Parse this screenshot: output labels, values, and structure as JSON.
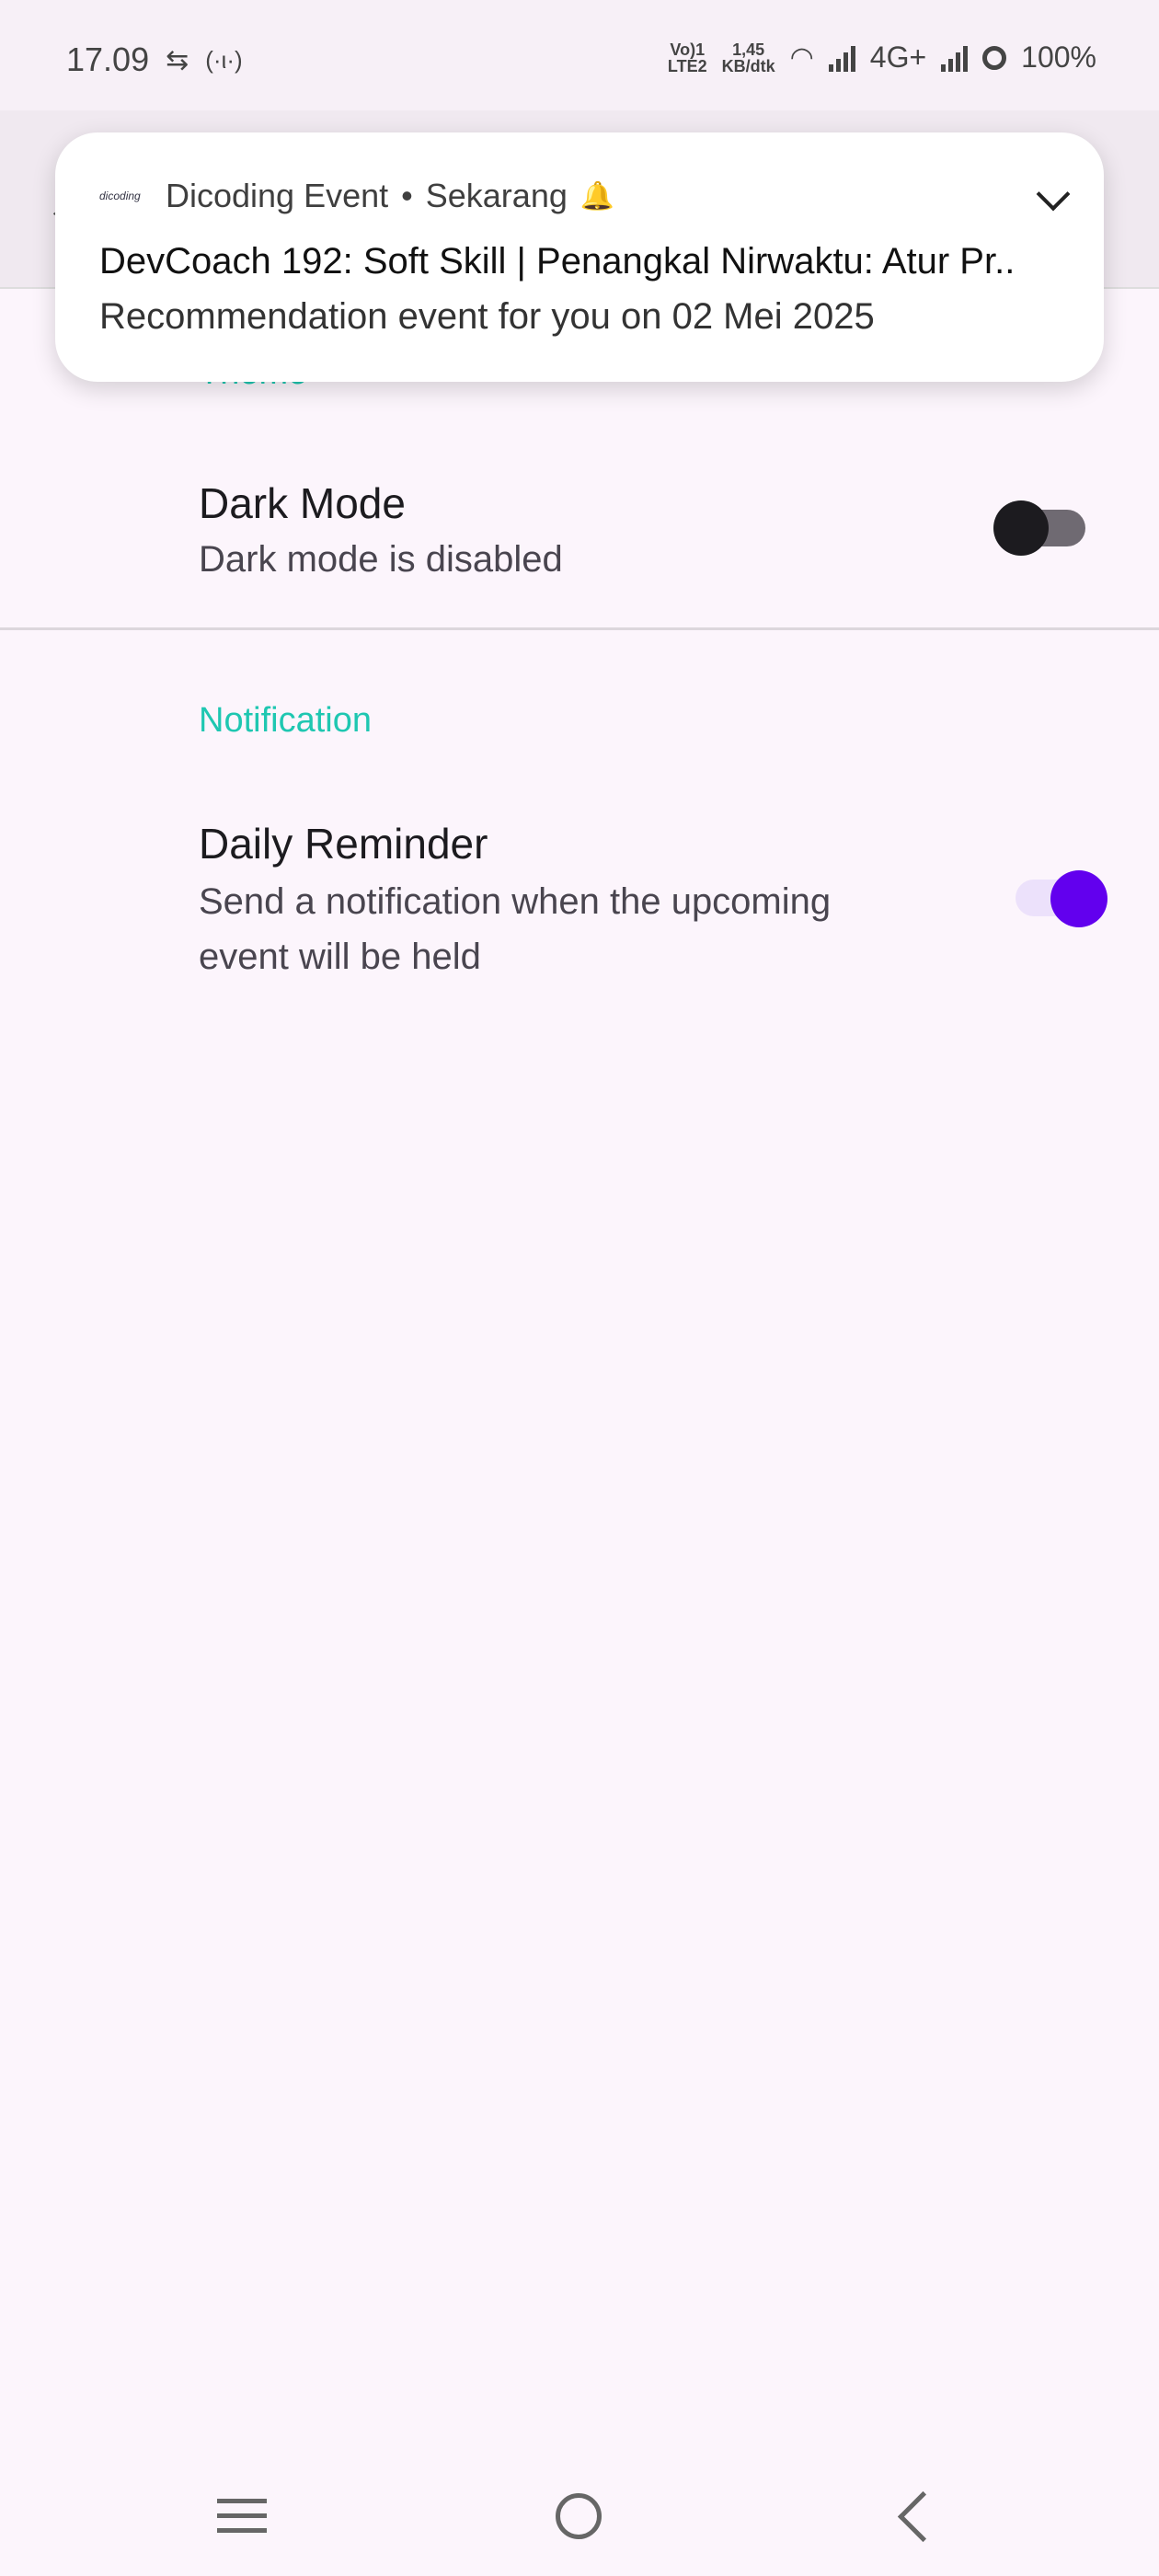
{
  "status_bar": {
    "time": "17.09",
    "volte_top": "Vo)1",
    "volte_bottom": "LTE2",
    "speed_top": "1,45",
    "speed_bottom": "KB/dtk",
    "network": "4G+",
    "battery": "100%"
  },
  "notification": {
    "logo_text": "dicoding",
    "app_name": "Dicoding Event",
    "separator": "•",
    "time": "Sekarang",
    "title": "DevCoach 192: Soft Skill | Penangkal Nirwaktu: Atur Pr..",
    "body": "Recommendation event for you on 02 Mei 2025"
  },
  "settings": {
    "theme_section": "Theme",
    "dark_mode": {
      "title": "Dark Mode",
      "subtitle": "Dark mode is disabled",
      "enabled": false
    },
    "notification_section": "Notification",
    "daily_reminder": {
      "title": "Daily Reminder",
      "subtitle": "Send a notification when the upcoming event will be held",
      "enabled": true
    }
  },
  "colors": {
    "accent_teal": "#1fc7b1",
    "switch_on": "#6200ee",
    "switch_off_thumb": "#1c1b1f",
    "background": "#fcf5fc"
  },
  "nav_bar": {
    "icons": [
      "menu-icon",
      "home-icon",
      "back-icon"
    ]
  }
}
